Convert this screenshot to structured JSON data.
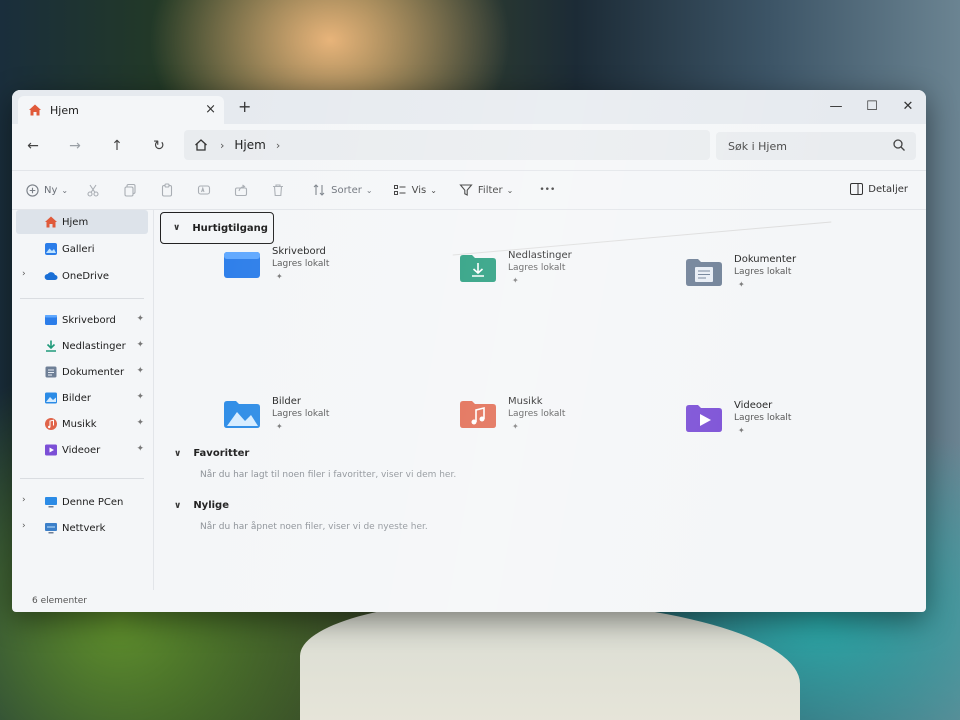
{
  "tab": {
    "title": "Hjem",
    "close": "×",
    "new": "+"
  },
  "window_controls": {
    "minimize": "—",
    "maximize": "☐",
    "close": "✕"
  },
  "nav": {
    "back": "←",
    "forward": "→",
    "up": "↑",
    "refresh": "↻"
  },
  "address": {
    "crumb": "Hjem",
    "sep1": "›",
    "sep2": "›"
  },
  "search": {
    "placeholder": "Søk i Hjem"
  },
  "toolbar": {
    "new_label": "Ny",
    "sort_label": "Sorter",
    "view_label": "Vis",
    "filter_label": "Filter",
    "more": "•••",
    "details_label": "Detaljer"
  },
  "sidebar": {
    "items": [
      {
        "label": "Hjem",
        "icon": "home-icon"
      },
      {
        "label": "Galleri",
        "icon": "gallery-icon"
      },
      {
        "label": "OneDrive",
        "icon": "cloud-icon"
      },
      {
        "label": "Skrivebord",
        "icon": "desktop-icon"
      },
      {
        "label": "Nedlastinger",
        "icon": "download-icon"
      },
      {
        "label": "Dokumenter",
        "icon": "documents-icon"
      },
      {
        "label": "Bilder",
        "icon": "pictures-icon"
      },
      {
        "label": "Musikk",
        "icon": "music-icon"
      },
      {
        "label": "Videoer",
        "icon": "video-icon"
      },
      {
        "label": "Denne PCen",
        "icon": "pc-icon"
      },
      {
        "label": "Nettverk",
        "icon": "network-icon"
      }
    ]
  },
  "main": {
    "quick_access": {
      "title": "Hurtigtilgang",
      "items": [
        {
          "name": "Skrivebord",
          "sub": "Lagres lokalt",
          "color": "#2b7de9"
        },
        {
          "name": "Nedlastinger",
          "sub": "Lagres lokalt",
          "color": "#1f9a7a"
        },
        {
          "name": "Dokumenter",
          "sub": "Lagres lokalt",
          "color": "#6e7f96"
        },
        {
          "name": "Bilder",
          "sub": "Lagres lokalt",
          "color": "#2b8be6"
        },
        {
          "name": "Musikk",
          "sub": "Lagres lokalt",
          "color": "#e0644a"
        },
        {
          "name": "Videoer",
          "sub": "Lagres lokalt",
          "color": "#7b4fd6"
        }
      ]
    },
    "favorites": {
      "title": "Favoritter",
      "empty": "Når du har lagt til noen filer i favoritter, viser vi dem her."
    },
    "recent": {
      "title": "Nylige",
      "empty": "Når du har åpnet noen filer, viser vi de nyeste her."
    }
  },
  "status": {
    "count": "6 elementer"
  },
  "glyphs": {
    "chev_down": "⌄",
    "chev_section": "∨",
    "chev_right": "›",
    "pin": "📌"
  }
}
